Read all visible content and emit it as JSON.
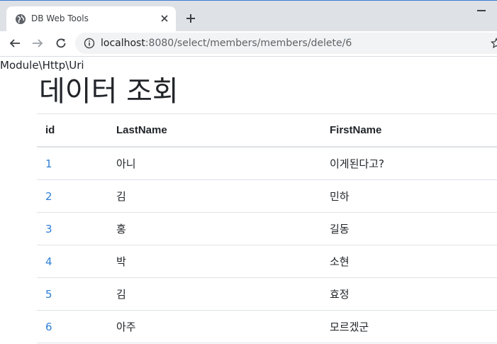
{
  "browser": {
    "tab_title": "DB Web Tools",
    "url_host": "localhost",
    "url_rest": ":8080/select/members/members/delete/6"
  },
  "page": {
    "module_line": "Module\\Http\\Uri",
    "title": "데이터 조회",
    "table": {
      "headers": [
        "id",
        "LastName",
        "FirstName"
      ],
      "rows": [
        {
          "id": "1",
          "last": "아니",
          "first": "이게된다고?"
        },
        {
          "id": "2",
          "last": "김",
          "first": "민하"
        },
        {
          "id": "3",
          "last": "홍",
          "first": "길동"
        },
        {
          "id": "4",
          "last": "박",
          "first": "소현"
        },
        {
          "id": "5",
          "last": "김",
          "first": "효정"
        },
        {
          "id": "6",
          "last": "아주",
          "first": "모르겠군"
        }
      ]
    }
  },
  "colors": {
    "link": "#2f80d7",
    "text": "#212529",
    "chrome_bg": "#dee1e6"
  }
}
